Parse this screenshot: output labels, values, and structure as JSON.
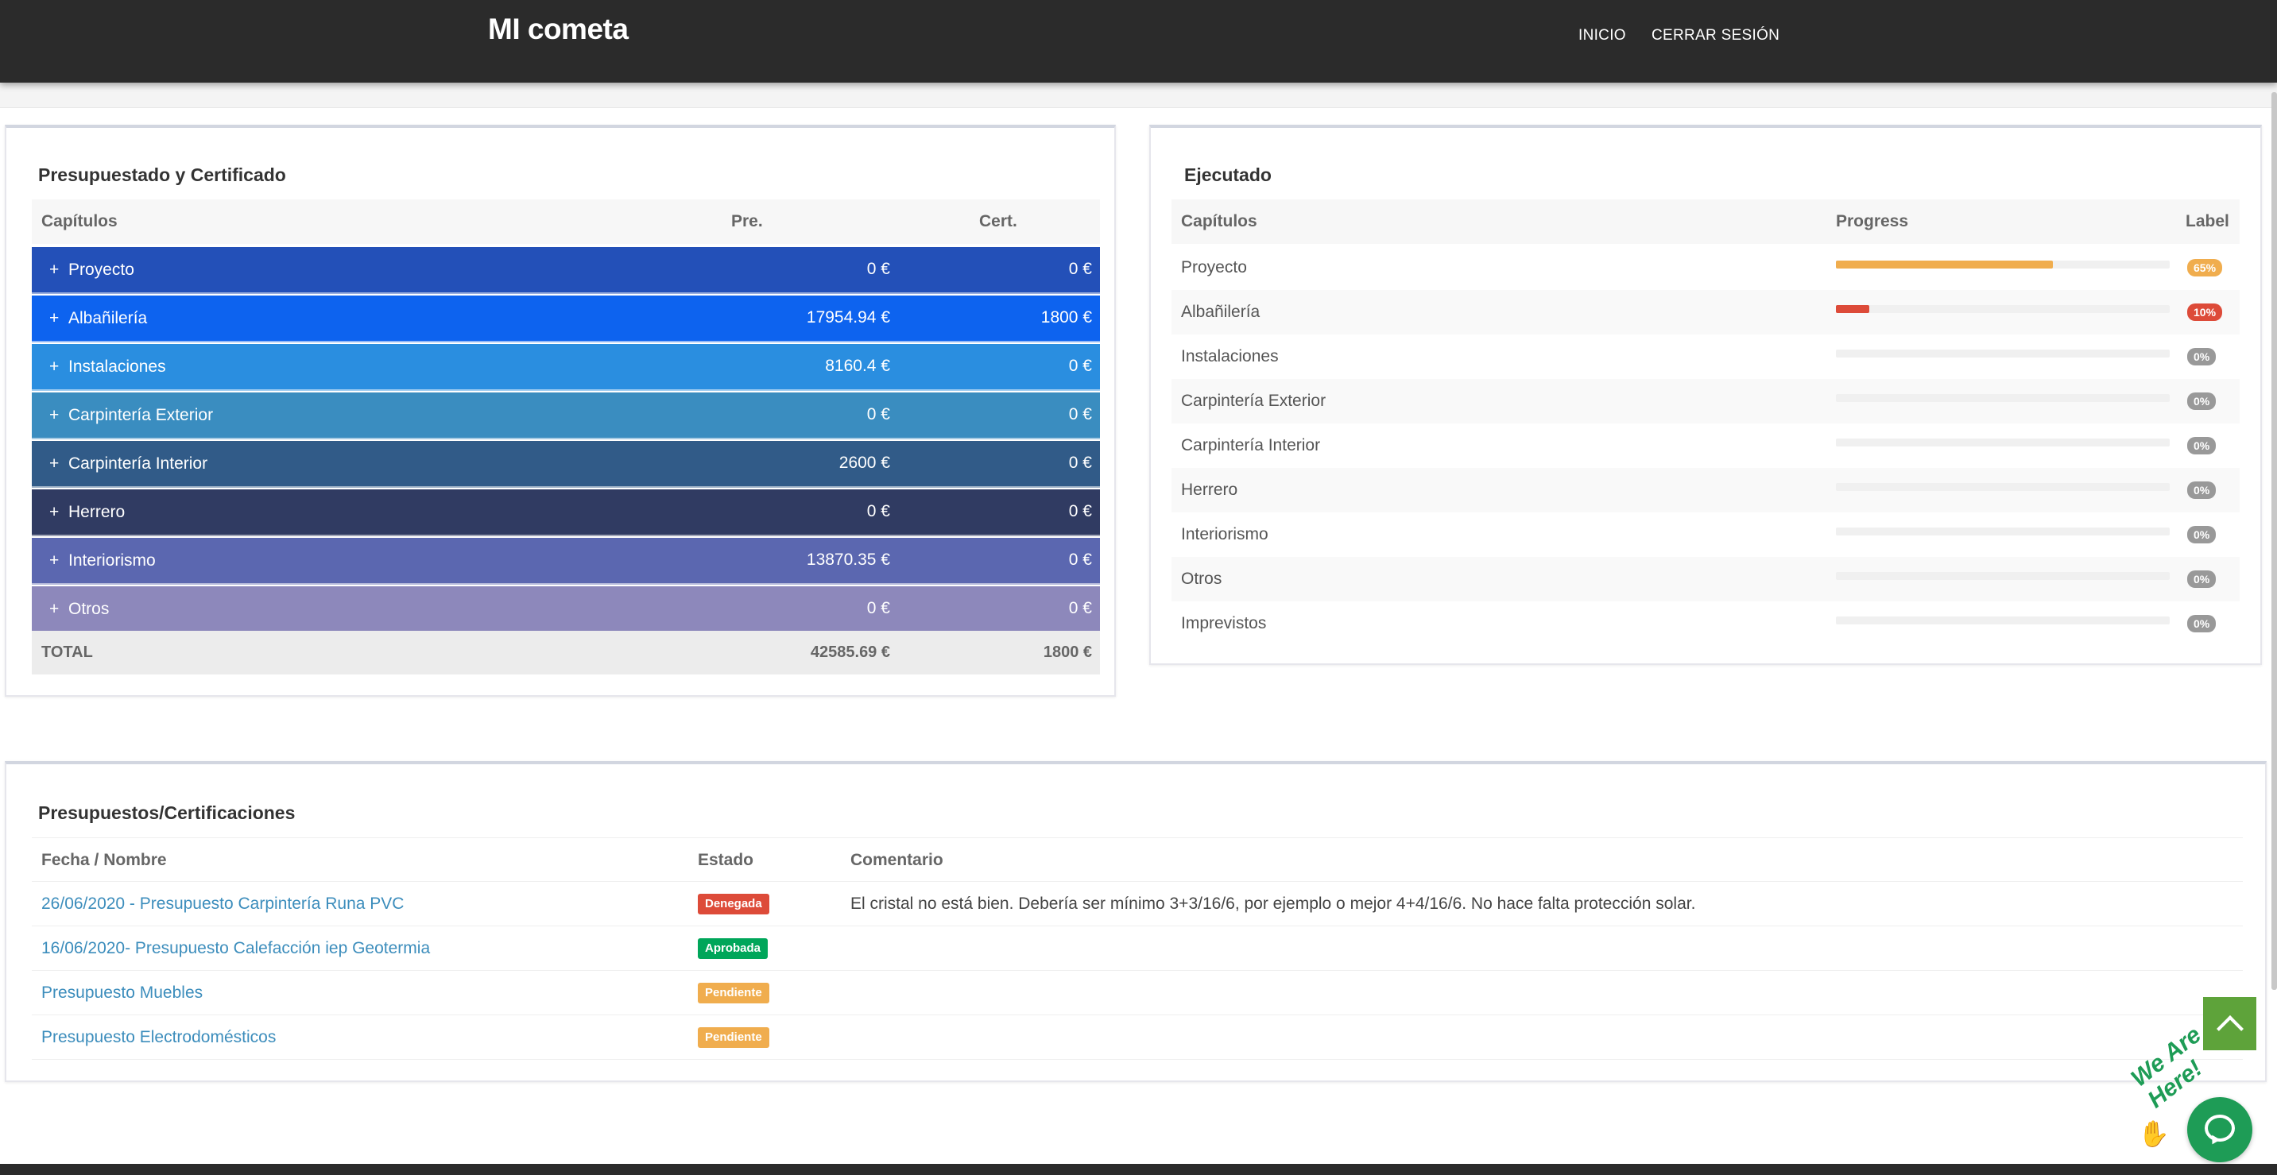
{
  "navbar": {
    "brand": "MI cometa",
    "links": [
      "INICIO",
      "CERRAR SESIÓN"
    ]
  },
  "budget_panel": {
    "title": "Presupuestado y Certificado",
    "columns": [
      "Capítulos",
      "Pre.",
      "Cert."
    ],
    "rows": [
      {
        "name": "Proyecto",
        "pre": "0 €",
        "cert": "0 €",
        "color": "#2350b8"
      },
      {
        "name": "Albañilería",
        "pre": "17954.94 €",
        "cert": "1800 €",
        "color": "#0d63ef"
      },
      {
        "name": "Instalaciones",
        "pre": "8160.4 €",
        "cert": "0 €",
        "color": "#2a8ee0"
      },
      {
        "name": "Carpintería Exterior",
        "pre": "0 €",
        "cert": "0 €",
        "color": "#3a8dc0"
      },
      {
        "name": "Carpintería Interior",
        "pre": "2600 €",
        "cert": "0 €",
        "color": "#315b88"
      },
      {
        "name": "Herrero",
        "pre": "0 €",
        "cert": "0 €",
        "color": "#303b62"
      },
      {
        "name": "Interiorismo",
        "pre": "13870.35 €",
        "cert": "0 €",
        "color": "#5b67b0"
      },
      {
        "name": "Otros",
        "pre": "0 €",
        "cert": "0 €",
        "color": "#8d88bb"
      }
    ],
    "plus_symbol": "+",
    "total": {
      "label": "TOTAL",
      "pre": "42585.69 €",
      "cert": "1800 €"
    }
  },
  "exec_panel": {
    "title": "Ejecutado",
    "columns": [
      "Capítulos",
      "Progress",
      "Label"
    ],
    "rows": [
      {
        "name": "Proyecto",
        "progress": 0.65,
        "label": "65%",
        "color": "#f0ad4e"
      },
      {
        "name": "Albañilería",
        "progress": 0.1,
        "label": "10%",
        "color": "#dd4b39"
      },
      {
        "name": "Instalaciones",
        "progress": 0,
        "label": "0%",
        "color": "#999999"
      },
      {
        "name": "Carpintería Exterior",
        "progress": 0,
        "label": "0%",
        "color": "#999999"
      },
      {
        "name": "Carpintería Interior",
        "progress": 0,
        "label": "0%",
        "color": "#999999"
      },
      {
        "name": "Herrero",
        "progress": 0,
        "label": "0%",
        "color": "#999999"
      },
      {
        "name": "Interiorismo",
        "progress": 0,
        "label": "0%",
        "color": "#999999"
      },
      {
        "name": "Otros",
        "progress": 0,
        "label": "0%",
        "color": "#999999"
      },
      {
        "name": "Imprevistos",
        "progress": 0,
        "label": "0%",
        "color": "#999999"
      }
    ]
  },
  "quotes_panel": {
    "title": "Presupuestos/Certificaciones",
    "columns": [
      "Fecha / Nombre",
      "Estado",
      "Comentario"
    ],
    "rows": [
      {
        "name": "26/06/2020 - Presupuesto Carpintería Runa PVC",
        "status": "Denegada",
        "status_color": "#dd4b39",
        "comment": "El cristal no está bien. Debería ser mínimo 3+3/16/6, por ejemplo o mejor 4+4/16/6. No hace falta protección solar."
      },
      {
        "name": "16/06/2020- Presupuesto Calefacción iep Geotermia",
        "status": "Aprobada",
        "status_color": "#00a65a",
        "comment": ""
      },
      {
        "name": "Presupuesto Muebles",
        "status": "Pendiente",
        "status_color": "#f0ad4e",
        "comment": ""
      },
      {
        "name": "Presupuesto Electrodomésticos",
        "status": "Pendiente",
        "status_color": "#f0ad4e",
        "comment": ""
      }
    ]
  },
  "chat_widget": {
    "tagline": "We Are Here!",
    "icon": "chat-icon"
  },
  "scroll_top": {
    "icon": "chevron-up-icon"
  }
}
